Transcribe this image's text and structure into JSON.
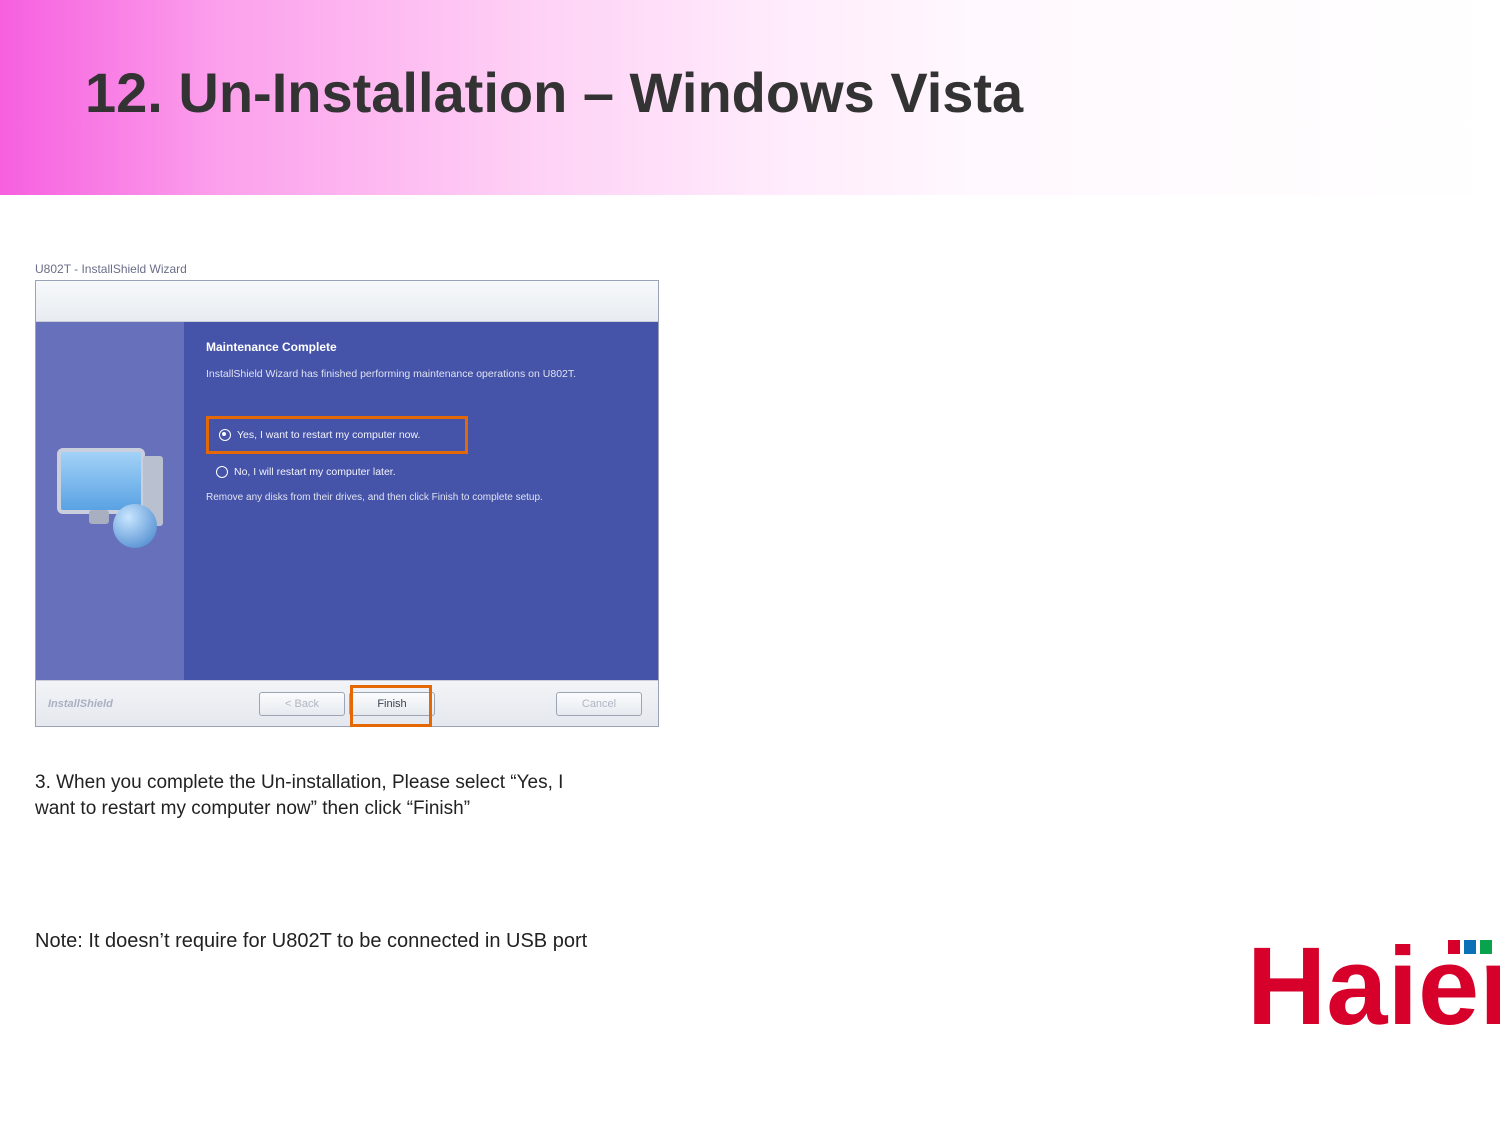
{
  "slide": {
    "title": "12. Un-Installation – Windows Vista",
    "instruction": "3. When you complete the Un-installation, Please select “Yes, I want to restart my computer now” then click “Finish”",
    "note": "Note: It doesn’t require for U802T to be connected in USB port",
    "logo_text": "Haier"
  },
  "wizard": {
    "window_title": "U802T - InstallShield Wizard",
    "heading": "Maintenance Complete",
    "subtext": "InstallShield Wizard has finished performing maintenance operations on U802T.",
    "radio_yes": "Yes, I want to restart my computer now.",
    "radio_no": "No, I will restart my computer later.",
    "hint": "Remove any disks from their drives, and then click Finish to complete setup.",
    "footer_brand": "InstallShield",
    "buttons": {
      "back": "< Back",
      "finish": "Finish",
      "cancel": "Cancel"
    }
  }
}
